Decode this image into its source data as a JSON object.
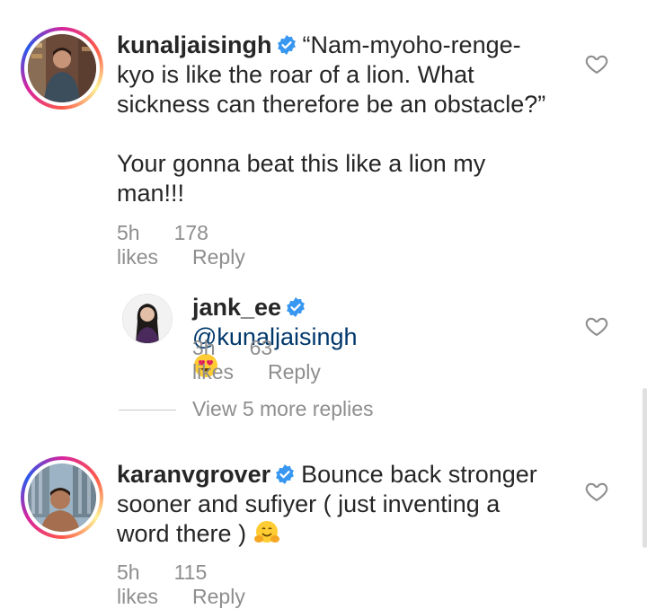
{
  "comments": [
    {
      "username": "kunaljaisingh",
      "text_line1": "“Nam-myoho-renge-",
      "text_line2": "kyo is like the roar of a lion. What",
      "text_line3": "sickness can therefore be an obstacle?”",
      "text_line4": "Your gonna beat this like a lion my",
      "text_line5": "man!!!",
      "time": "5h",
      "likes": "178 likes",
      "reply": "Reply"
    },
    {
      "username": "jank_ee",
      "mention": "@kunaljaisingh",
      "emoji": "heart-eyes-emoji",
      "time": "3h",
      "likes": "63 likes",
      "reply": "Reply"
    },
    {
      "username": "karanvgrover",
      "text_line1": "Bounce back stronger",
      "text_line2": "sooner and sufiyer ( just inventing a",
      "text_line3": "word there )",
      "emoji": "hugging-face-emoji",
      "time": "5h",
      "likes": "115 likes",
      "reply": "Reply"
    }
  ],
  "view_more": "View 5 more replies",
  "colors": {
    "text": "#262626",
    "meta": "#8e8e8e",
    "mention": "#00376b",
    "verified": "#3897f0"
  }
}
